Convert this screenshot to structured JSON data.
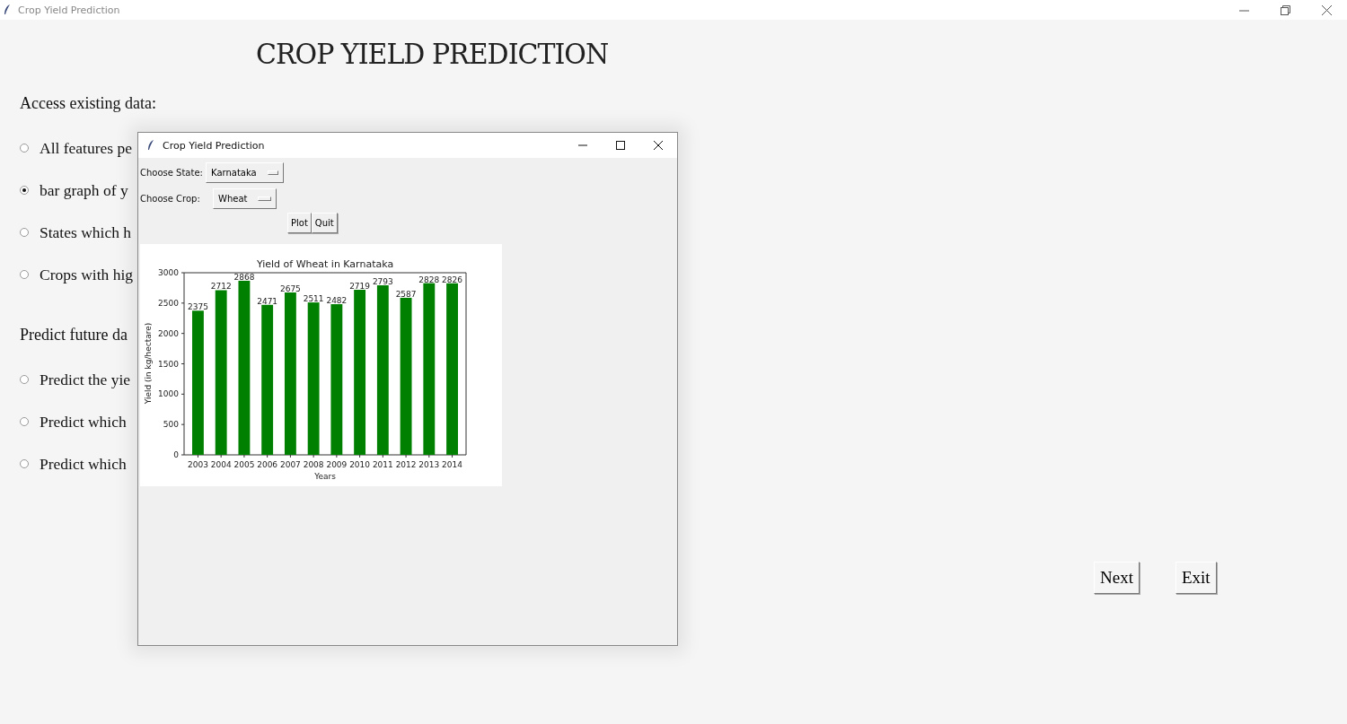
{
  "window": {
    "title": "Crop Yield Prediction"
  },
  "heading": "CROP YIELD PREDICTION",
  "sections": [
    {
      "title": "Access existing data:",
      "options": [
        {
          "label": "All features pe",
          "selected": false
        },
        {
          "label": "bar graph of y",
          "selected": true
        },
        {
          "label": "States which h",
          "selected": false
        },
        {
          "label": "Crops with hig",
          "selected": false
        }
      ]
    },
    {
      "title": "Predict future da",
      "options": [
        {
          "label": "Predict the yie",
          "selected": false
        },
        {
          "label": "Predict which",
          "selected": false
        },
        {
          "label": "Predict which",
          "selected": false
        }
      ]
    }
  ],
  "buttons": [
    "Next",
    "Exit"
  ],
  "dialog": {
    "title": "Crop Yield Prediction",
    "fields": [
      {
        "label": "Choose State:",
        "value": "Karnataka"
      },
      {
        "label": "Choose Crop:",
        "value": "Wheat"
      }
    ],
    "buttons": [
      "Plot",
      "Quit"
    ],
    "chart_data": {
      "type": "bar",
      "title": "Yield of Wheat in Karnataka",
      "xlabel": "Years",
      "ylabel": "Yield (in kg/hectare)",
      "categories": [
        "2003",
        "2004",
        "2005",
        "2006",
        "2007",
        "2008",
        "2009",
        "2010",
        "2011",
        "2012",
        "2013",
        "2014"
      ],
      "series": [
        {
          "color": "#008000",
          "values": [
            2375,
            2712,
            2868,
            2471,
            2675,
            2511,
            2482,
            2719,
            2793,
            2587,
            2828,
            2826
          ]
        }
      ],
      "ylim": [
        0,
        3000
      ],
      "yticks": [
        0,
        500,
        1000,
        1500,
        2000,
        2500,
        3000
      ],
      "data_labels": true
    }
  }
}
